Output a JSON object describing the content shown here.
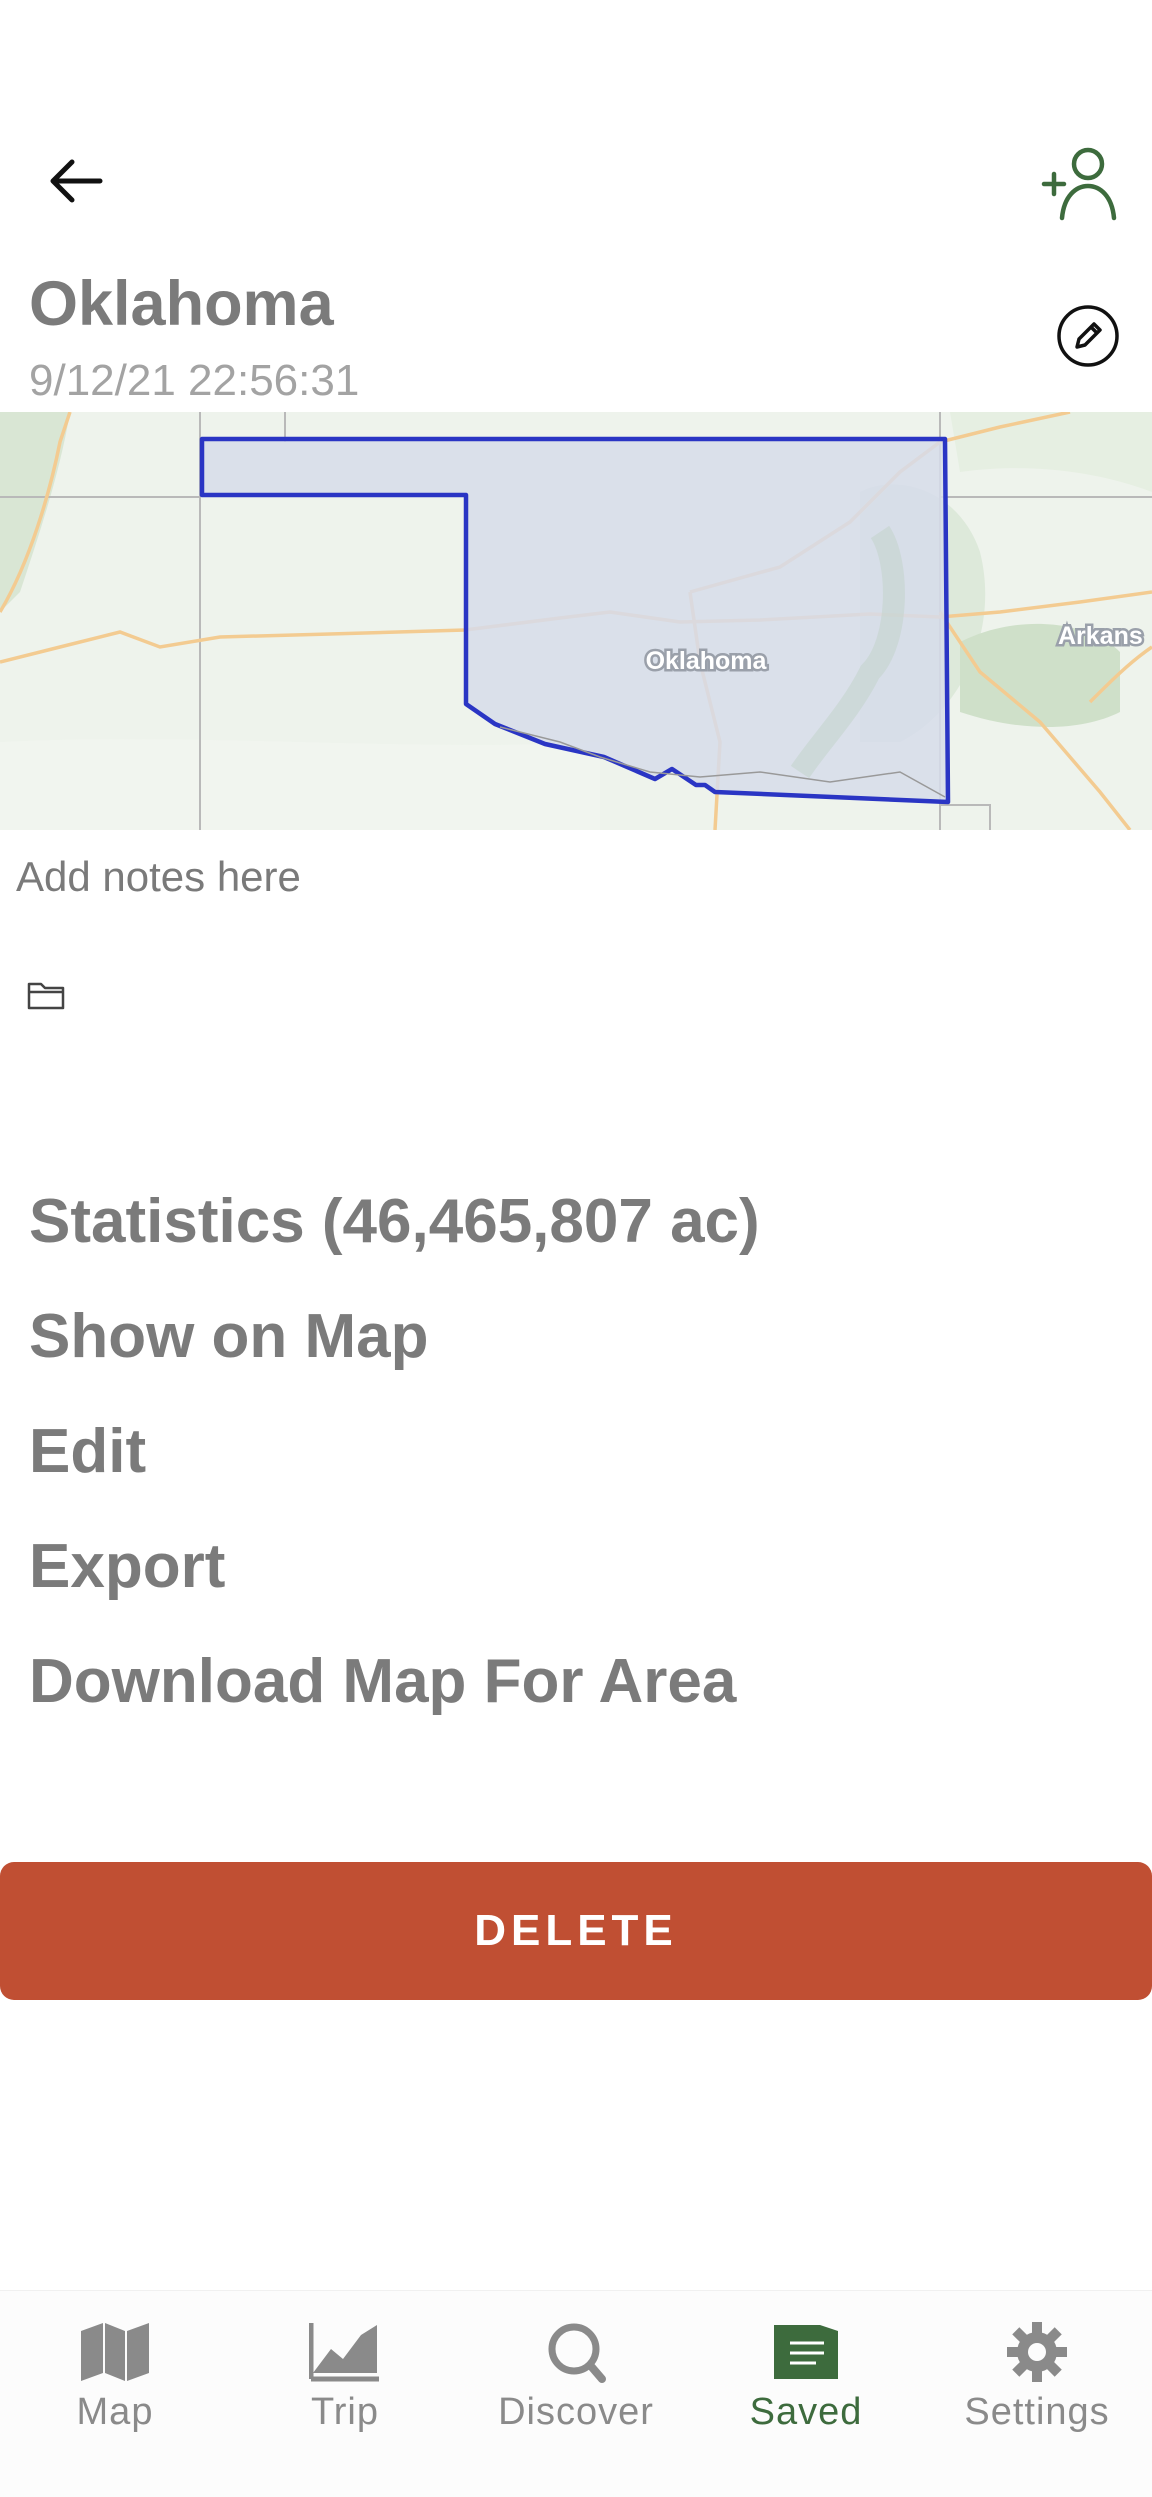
{
  "header": {
    "title": "Oklahoma",
    "timestamp": "9/12/21 22:56:31"
  },
  "map": {
    "state_label": "Oklahoma",
    "edge_label": "Arkans"
  },
  "notes": {
    "placeholder": "Add notes here"
  },
  "actions": [
    {
      "label": "Statistics (46,465,807 ac)"
    },
    {
      "label": "Show on Map"
    },
    {
      "label": "Edit"
    },
    {
      "label": "Export"
    },
    {
      "label": "Download Map For Area"
    }
  ],
  "delete_label": "DELETE",
  "nav": [
    {
      "label": "Map",
      "icon": "map-icon"
    },
    {
      "label": "Trip",
      "icon": "trip-chart-icon"
    },
    {
      "label": "Discover",
      "icon": "discover-search-icon"
    },
    {
      "label": "Saved",
      "icon": "saved-folder-icon",
      "active": true
    },
    {
      "label": "Settings",
      "icon": "settings-gear-icon"
    }
  ],
  "colors": {
    "accent_green": "#3d6b3d",
    "delete_red": "#c04f33",
    "boundary_blue": "#2a35c4",
    "boundary_fill": "#d6dcea"
  }
}
